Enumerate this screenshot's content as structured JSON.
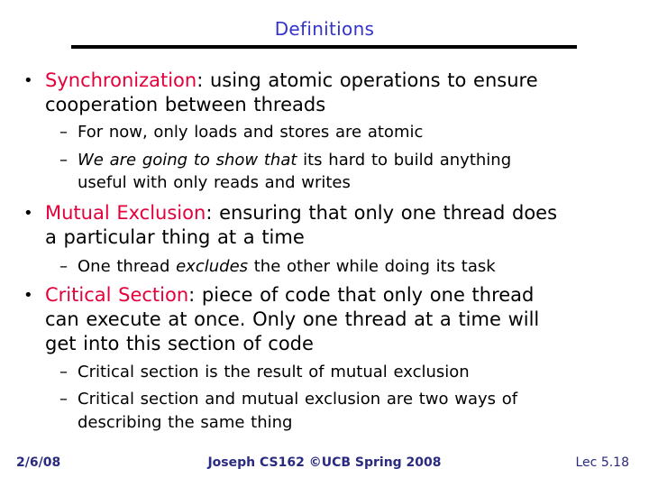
{
  "slide": {
    "title": "Definitions",
    "colors": {
      "title": "#3333cc",
      "term": "#e4003a",
      "body": "#000000",
      "footer": "#2a2a80"
    },
    "bullets": [
      {
        "term": "Synchronization",
        "separator": ":",
        "lines": [
          " using atomic operations to ensure",
          "cooperation between threads"
        ],
        "subs": [
          {
            "parts": [
              {
                "text": "For now, only loads and stores are atomic",
                "italic": false
              }
            ]
          },
          {
            "parts": [
              {
                "text": "We are going to show that",
                "italic": true
              },
              {
                "text": " its hard to build anything",
                "italic": false
              }
            ],
            "continuation": "useful with only reads and writes"
          }
        ]
      },
      {
        "term": "Mutual Exclusion",
        "separator": ":",
        "lines": [
          " ensuring that only one thread does",
          "a particular thing at a time"
        ],
        "subs": [
          {
            "parts": [
              {
                "text": "One thread ",
                "italic": true
              },
              {
                "text": "excludes",
                "italic": true
              },
              {
                "text": " the other while doing its task",
                "italic": false
              }
            ]
          }
        ]
      },
      {
        "term": "Critical Section",
        "separator": ":",
        "lines": [
          " piece of code that only one thread",
          "can execute at once. Only one thread at a time will",
          "get into this section of code"
        ],
        "subs": [
          {
            "parts": [
              {
                "text": "Critical section",
                "italic": true
              },
              {
                "text": " is the result of mutual exclusion",
                "italic": false
              }
            ]
          },
          {
            "parts": [
              {
                "text": "Critical section",
                "italic": true
              },
              {
                "text": " and mutual exclusion are two ways of",
                "italic": false
              }
            ],
            "continuation": "describing the same thing"
          }
        ]
      }
    ],
    "footer": {
      "date": "2/6/08",
      "course": "Joseph CS162 ©UCB Spring 2008",
      "page": "Lec 5.18"
    },
    "bullet_glyph": "•",
    "dash_glyph": "–"
  }
}
